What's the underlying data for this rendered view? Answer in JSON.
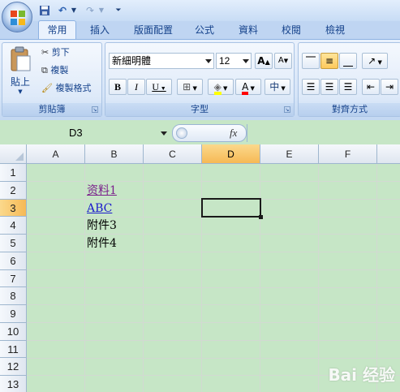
{
  "quick_access": {
    "save_icon": "save-icon",
    "undo_icon": "undo-icon",
    "redo_icon": "redo-icon",
    "customize_icon": "customize-qat-icon"
  },
  "tabs": [
    "常用",
    "插入",
    "版面配置",
    "公式",
    "資料",
    "校閱",
    "檢視"
  ],
  "active_tab": "常用",
  "clipboard": {
    "paste_label": "貼上",
    "cut_label": "剪下",
    "copy_label": "複製",
    "format_painter_label": "複製格式",
    "group_label": "剪貼簿"
  },
  "font": {
    "font_name": "新細明體",
    "font_size": "12",
    "grow_label": "A",
    "shrink_label": "A",
    "bold_label": "B",
    "italic_label": "I",
    "underline_label": "U",
    "font_color_label": "A",
    "phonetic_label": "中",
    "group_label": "字型",
    "fill_color": "#ffff00",
    "font_color": "#ff0000"
  },
  "alignment": {
    "group_label": "對齊方式"
  },
  "formula_bar": {
    "name_box": "D3",
    "fx_label": "fx",
    "formula_value": ""
  },
  "sheet": {
    "columns": [
      "A",
      "B",
      "C",
      "D",
      "E",
      "F"
    ],
    "selected_column": "D",
    "rows": [
      "1",
      "2",
      "3",
      "4",
      "5",
      "6",
      "7",
      "8",
      "9",
      "10",
      "11",
      "12",
      "13"
    ],
    "selected_row": "3",
    "cells": {
      "B2": "资料1",
      "B3": "ABC",
      "B4": "附件3",
      "B5": "附件4"
    },
    "active_cell": "D3"
  },
  "watermark": "Bai 经验",
  "colors": {
    "grid_background": "#c6e6c6",
    "ribbon_blue": "#d5e4f7",
    "link": "#1a1acc",
    "visited_link": "#7b1f8c",
    "selected_header": "#f6b955"
  }
}
